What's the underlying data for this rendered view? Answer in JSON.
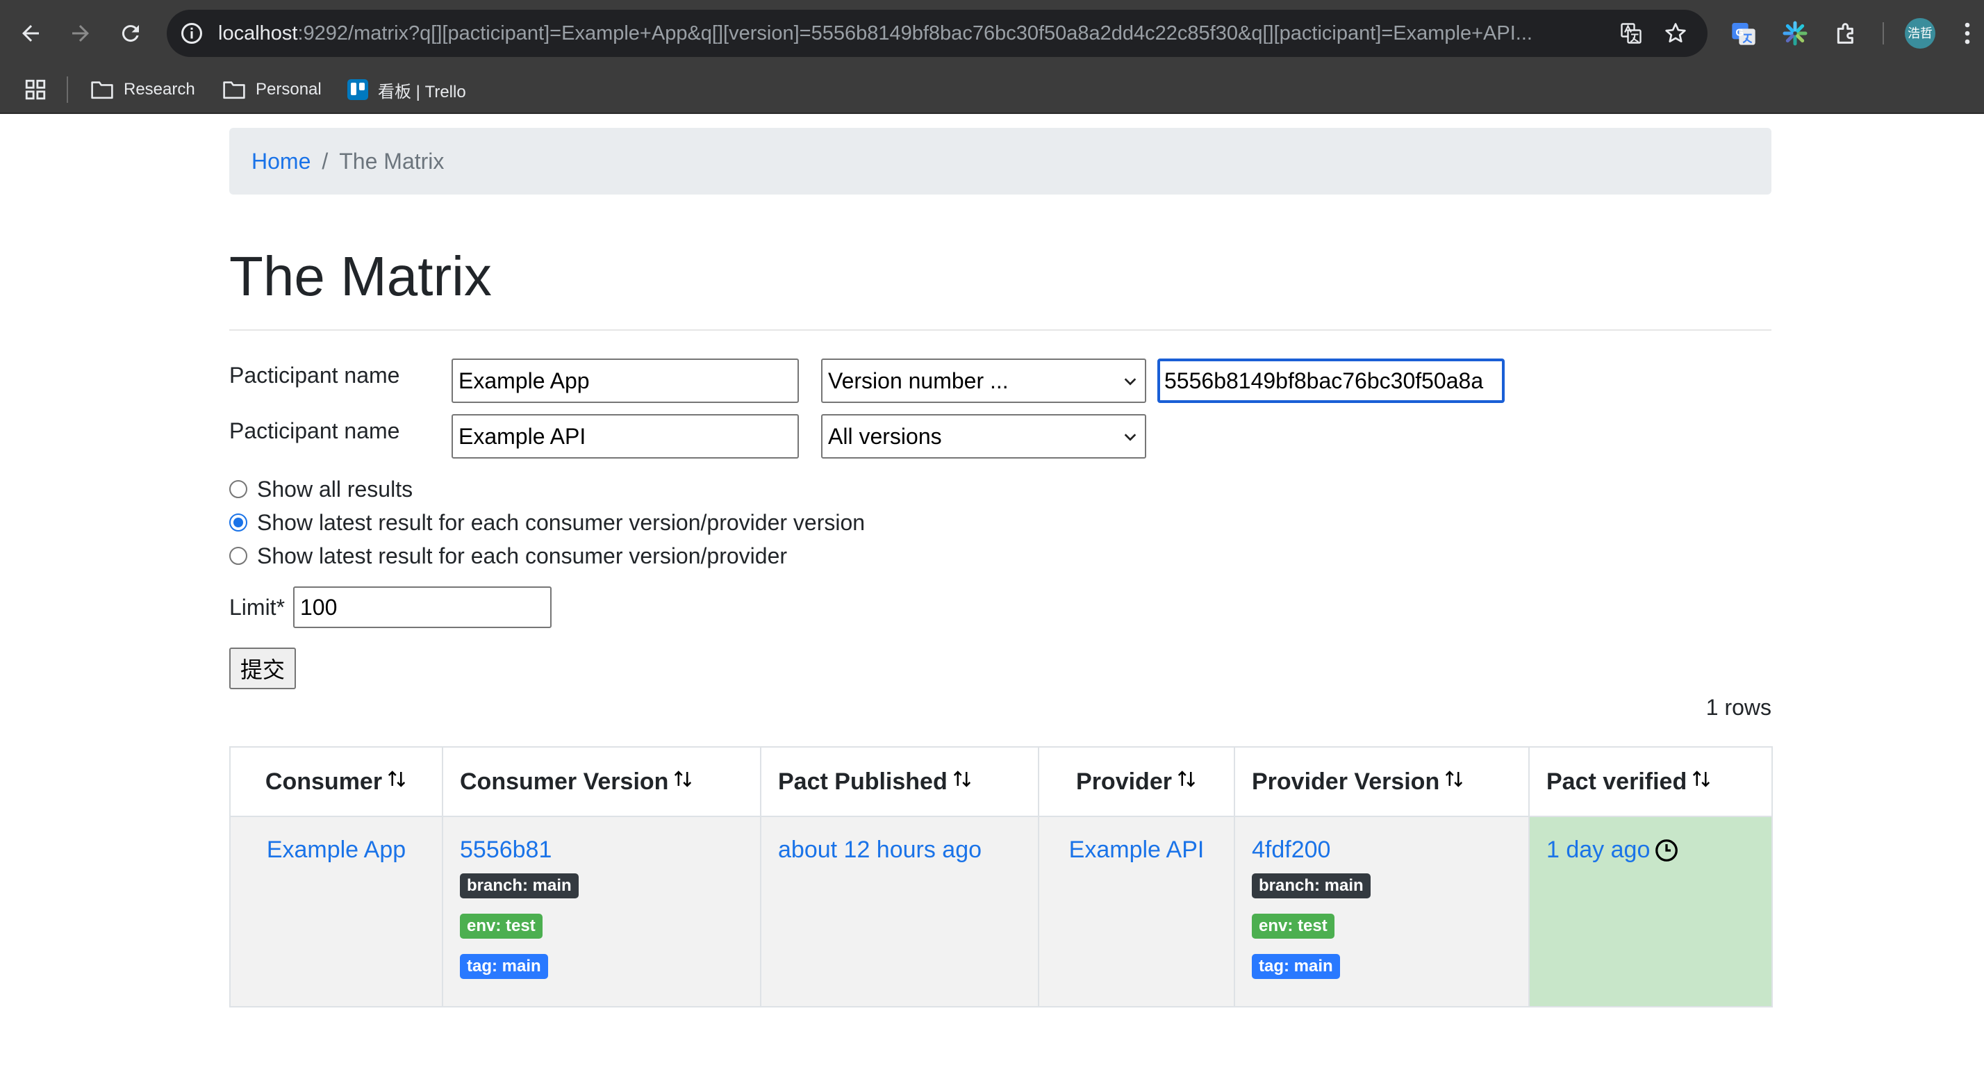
{
  "browser": {
    "url_host": "localhost",
    "url_rest": ":9292/matrix?q[][pacticipant]=Example+App&q[][version]=5556b8149bf8bac76bc30f50a8a2dd4c22c85f30&q[][pacticipant]=Example+API...",
    "profile_initials": "浩哲",
    "icons": [
      "back-icon",
      "forward-icon",
      "reload-icon",
      "info-icon",
      "translate-icon",
      "star-icon",
      "google-translate-icon",
      "spark-extension-icon",
      "extensions-puzzle-icon",
      "menu-dots-icon"
    ]
  },
  "bookmarks": [
    {
      "label": "Research",
      "icon": "folder-icon"
    },
    {
      "label": "Personal",
      "icon": "folder-icon"
    },
    {
      "label": "看板 | Trello",
      "icon": "trello-icon"
    }
  ],
  "breadcrumb": {
    "home": "Home",
    "separator": "/",
    "current": "The Matrix"
  },
  "page_title": "The Matrix",
  "form": {
    "rows": [
      {
        "label": "Pacticipant name",
        "name_value": "Example App",
        "version_select": "Version number ...",
        "version_value": "5556b8149bf8bac76bc30f50a8a"
      },
      {
        "label": "Pacticipant name",
        "name_value": "Example API",
        "version_select": "All versions"
      }
    ],
    "radios": [
      {
        "label": "Show all results",
        "checked": false
      },
      {
        "label": "Show latest result for each consumer version/provider version",
        "checked": true
      },
      {
        "label": "Show latest result for each consumer version/provider",
        "checked": false
      }
    ],
    "limit_label": "Limit*",
    "limit_value": "100",
    "submit_label": "提交"
  },
  "rows_count": "1 rows",
  "table": {
    "headers": [
      "Consumer",
      "Consumer Version",
      "Pact Published",
      "Provider",
      "Provider Version",
      "Pact verified"
    ],
    "row": {
      "consumer": "Example App",
      "consumer_version": "5556b81",
      "consumer_badges": [
        {
          "text": "branch: main",
          "color": "#343a40"
        },
        {
          "text": "env: test",
          "color": "#4caf50"
        },
        {
          "text": "tag: main",
          "color": "#2979ff"
        }
      ],
      "pact_published": "about 12 hours ago",
      "provider": "Example API",
      "provider_version": "4fdf200",
      "provider_badges": [
        {
          "text": "branch: main",
          "color": "#343a40"
        },
        {
          "text": "env: test",
          "color": "#4caf50"
        },
        {
          "text": "tag: main",
          "color": "#2979ff"
        }
      ],
      "pact_verified": "1 day ago",
      "verified_bg": "#c8e6c9"
    }
  },
  "colors": {
    "link": "#1a73e8",
    "chrome": "#3c3c3c",
    "omnibox": "#202124"
  }
}
